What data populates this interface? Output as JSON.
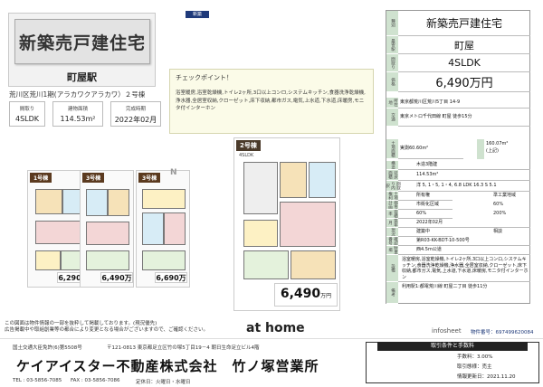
{
  "header": {
    "title": "新築売戸建住宅",
    "subtitle": "町屋駅",
    "address": "荒川区荒川1期(アラカワクアラカワ）２号棟",
    "new_badge": "新築"
  },
  "specs": [
    {
      "label": "間取り",
      "value": "4SLDK"
    },
    {
      "label": "建物面積",
      "value": "114.53m²"
    },
    {
      "label": "完成時期",
      "value": "2022年02月"
    }
  ],
  "checkpoint": {
    "title": "チェックポイント！",
    "text": "浴室暖房,浴室乾燥機,トイレ2ヶ所,3口以上コンロ,システムキッチン,食器洗浄乾燥機,浄水器,全居室収納,クローゼット,床下収納,都市ガス,電気,上水道,下水道,床暖房,モニタ付インターホン"
  },
  "panel": {
    "type_label": "種別",
    "type": "新築売戸建住宅",
    "station_label": "最寄駅",
    "station": "町屋",
    "layout_label": "間取り",
    "layout": "4SLDK",
    "price_label": "価格",
    "price": "6,490万円",
    "address_label": "所在地",
    "address": "東京都荒川区荒川5丁目 14-9",
    "transport_label": "交通",
    "transport": "東京メトロ千代田線 町屋 徒歩15分",
    "land_label": "土地面積",
    "land": "実測60.60m²",
    "private_road_label": "私道負担",
    "private_road": "",
    "building_area": "160.07m²",
    "building_area_note": "(上記)",
    "structure_label": "構造",
    "structure": "木造3階建",
    "floor_area_label": "延床面積",
    "floor_area": "114.53m²",
    "rooms_label": "間取り内訳",
    "rooms": "洋 5, 1・5, 1・4, 6.8 LDK 16.3 S 5.1",
    "land_right_label": "土地権利",
    "land_right": "所有権",
    "zoning_label": "用途地域",
    "zoning": "準工業地域",
    "city_plan_label": "都市計画",
    "city_plan": "市街化区域",
    "coverage_label": "建ぺい率",
    "coverage": "60%",
    "far_label": "容積率",
    "far": "200%",
    "built_label": "築年月",
    "built": "2022年02月",
    "status_label": "現況",
    "status": "建築中",
    "handover_label": "引渡",
    "handover": "相談",
    "permit_label": "確認番号",
    "permit": "第R03-KK-BDT-10-500号",
    "parking_label": "駐車場",
    "parking": "",
    "other_label": "その他",
    "other": "西4.5m公道",
    "equipment_label": "設備",
    "equipment": "浴室暖房,浴室乾燥機,トイレ2ヶ所,3口以上コンロ,システムキッチン,食器洗浄乾燥機,浄水器,全居室収納,クローゼット,床下収納,都市ガス,電気,上水道,下水道,床暖房,モニタ付インターホン",
    "note_label": "備考",
    "note": "利用駅1:都電荒川線 町屋二丁目 徒歩11分"
  },
  "plans": {
    "tag1": "1号棟",
    "tag2": "2号棟",
    "tag3": "3号棟",
    "price1": "6,290万",
    "price2": "6,490万",
    "price3": "6,690万",
    "main_tag": "2号棟",
    "main_layout": "4SLDK",
    "main_price": "6,490",
    "main_unit": "万円",
    "direction": "N"
  },
  "disclaimer": "この図面は物件情報の一部を抜粋して掲載しております。(現況優先)\n広告掲載中や取組創業等の都合により変更となる場合がございますので、ご確認ください。",
  "logo": "at home",
  "brand": "infosheet",
  "property_number": "物件番号：697499620084",
  "company": {
    "license": "国土交通大臣免許(6)第5508号",
    "address": "〒121-0813 東京都足立区竹の塚5丁目19－4 朝日生命足立ビル4階",
    "name": "ケイアイスター不動産株式会社　竹ノ塚営業所",
    "tel": "TEL : 03-5856-7085",
    "fax": "FAX : 03-5856-7086",
    "holiday": "定休日：火曜日・水曜日"
  },
  "transaction": {
    "head": "取引条件と手数料",
    "fee": "手数料：3.00%",
    "type": "取引態様：売主",
    "updated": "情報更新日：2021.11.20"
  }
}
